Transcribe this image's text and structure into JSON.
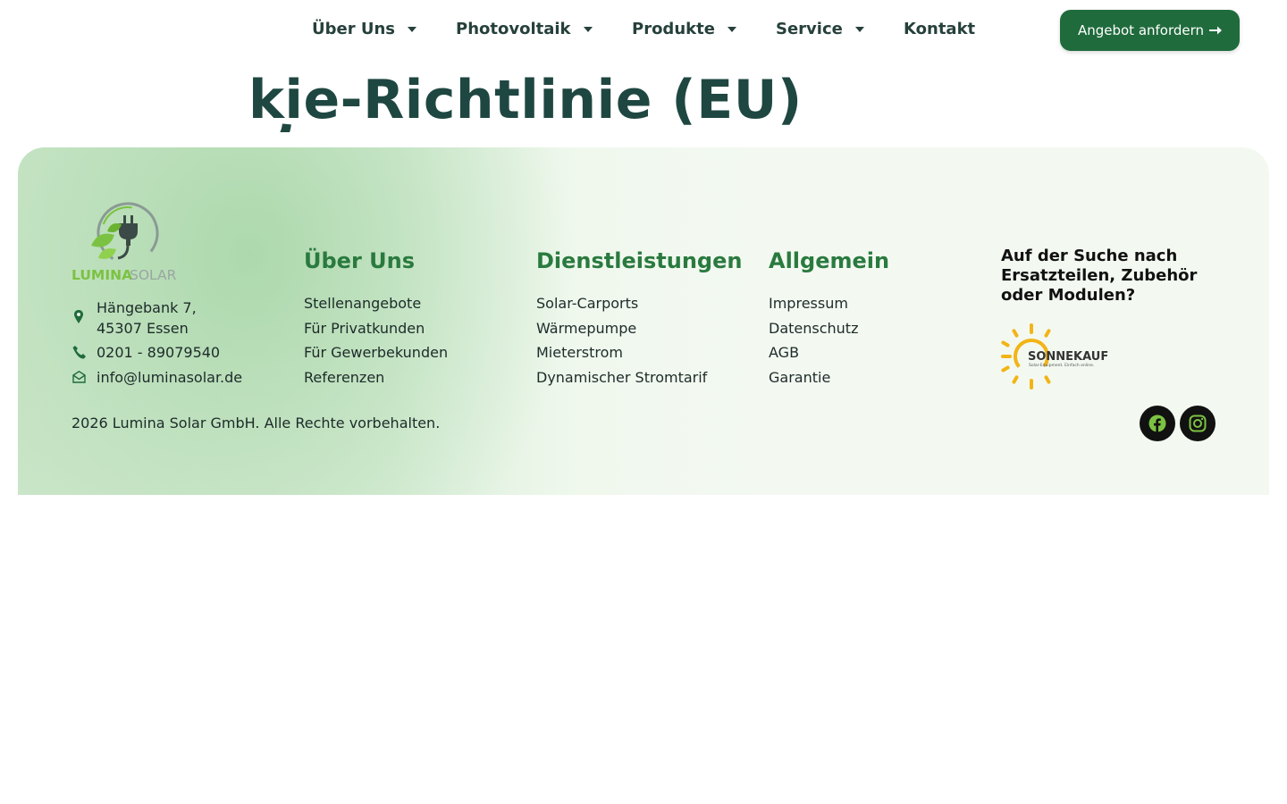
{
  "nav": {
    "items": [
      {
        "label": "Über Uns",
        "has_dropdown": true
      },
      {
        "label": "Photovoltaik",
        "has_dropdown": true
      },
      {
        "label": "Produkte",
        "has_dropdown": true
      },
      {
        "label": "Service",
        "has_dropdown": true
      },
      {
        "label": "Kontakt",
        "has_dropdown": false
      }
    ],
    "cta_label": "Angebot anfordern",
    "cta_icon": "arrow-right-icon"
  },
  "hero": {
    "title_visible": "kie-Richtlinie (EU)"
  },
  "footer": {
    "logo": {
      "brand_primary": "LUMINA",
      "brand_secondary": "SOLAR"
    },
    "contact": {
      "address_line1": "Hängebank 7,",
      "address_line2": "45307 Essen",
      "phone": "0201 - 89079540",
      "email": "info@luminasolar.de"
    },
    "columns": [
      {
        "title": "Über Uns",
        "links": [
          "Stellenangebote",
          "Für Privatkunden",
          "Für Gewerbekunden",
          "Referenzen"
        ]
      },
      {
        "title": "Dienstleistungen",
        "links": [
          "Solar-Carports",
          "Wärmepumpe",
          "Mieterstrom",
          "Dynamischer Stromtarif"
        ]
      },
      {
        "title": "Allgemein",
        "links": [
          "Impressum",
          "Datenschutz",
          "AGB",
          "Garantie"
        ]
      }
    ],
    "search_heading": "Auf der Suche nach Ersatzteilen, Zubehör oder Modulen?",
    "partner_logo": {
      "name": "SONNEKAUF",
      "tagline": "Solar-Equipment. Einfach online."
    },
    "copyright": "2026 Lumina Solar GmbH. Alle Rechte vorbehalten.",
    "social": [
      "facebook-icon",
      "instagram-icon"
    ]
  },
  "colors": {
    "brand_green": "#1f6b3c",
    "heading_green": "#2a7a3f",
    "logo_green": "#7cc242",
    "sun_yellow": "#f2b417",
    "nav_text": "#26403c",
    "hero_text": "#1f4741"
  }
}
